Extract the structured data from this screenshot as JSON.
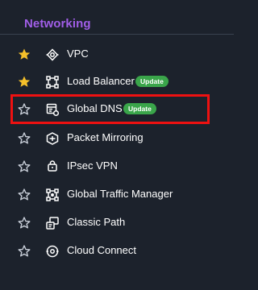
{
  "header": {
    "title": "Networking"
  },
  "items": [
    {
      "label": "VPC",
      "favorite": true,
      "icon": "vpc-icon"
    },
    {
      "label": "Load Balancer",
      "favorite": true,
      "icon": "load-balancer-icon",
      "badge": "Update"
    },
    {
      "label": "Global DNS",
      "favorite": false,
      "icon": "global-dns-icon",
      "badge": "Update"
    },
    {
      "label": "Packet Mirroring",
      "favorite": false,
      "icon": "packet-mirroring-icon"
    },
    {
      "label": "IPsec VPN",
      "favorite": false,
      "icon": "ipsec-vpn-icon"
    },
    {
      "label": "Global Traffic Manager",
      "favorite": false,
      "icon": "global-traffic-manager-icon"
    },
    {
      "label": "Classic Path",
      "favorite": false,
      "icon": "classic-path-icon"
    },
    {
      "label": "Cloud Connect",
      "favorite": false,
      "icon": "cloud-connect-icon"
    }
  ],
  "colors": {
    "background": "#1c222c",
    "heading": "#a15ee8",
    "favorite_star": "#f5c02a",
    "badge": "#3aa54a",
    "highlight": "#ee1111"
  }
}
